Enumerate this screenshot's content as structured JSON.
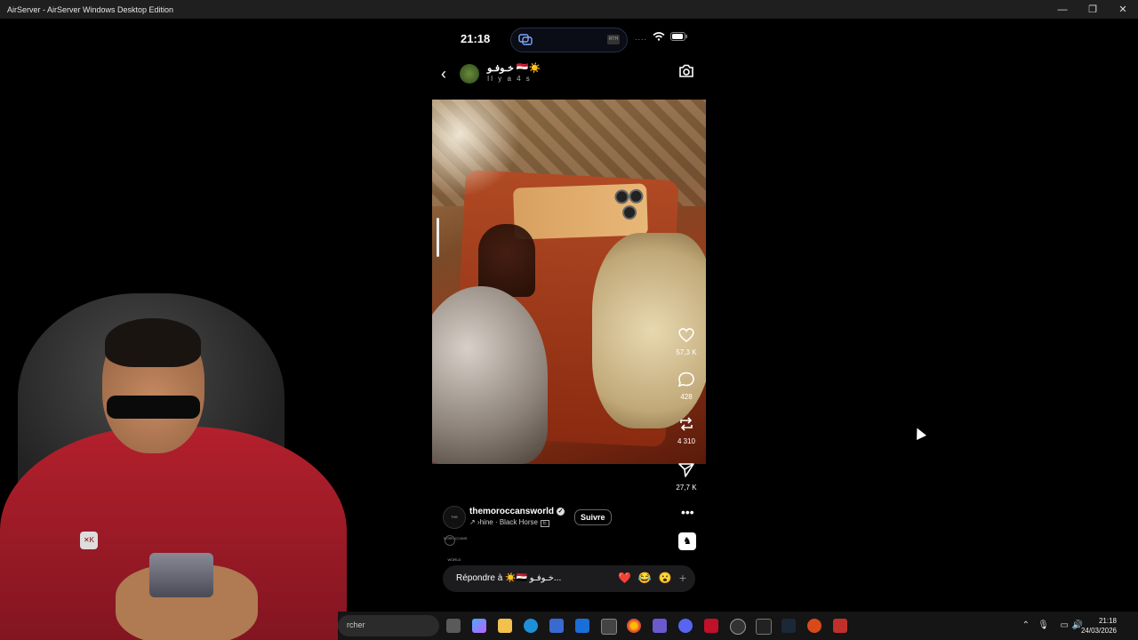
{
  "window": {
    "title": "AirServer - AirServer Windows Desktop Edition",
    "minimize": "—",
    "restore": "❐",
    "close": "✕"
  },
  "phone_status": {
    "time": "21:18",
    "dots": "....",
    "badge": "RTH"
  },
  "story": {
    "username": "خـوفـو 🇪🇬☀️",
    "time_ago": "Il y a 4 s",
    "back_icon": "chevron-left-icon",
    "camera_icon": "camera-icon"
  },
  "actions": {
    "likes": "57,3 K",
    "comments": "428",
    "reposts": "4 310",
    "shares": "27,7 K"
  },
  "post": {
    "account": "themoroccansworld",
    "account_avatar_text": "THE MOROCCANS WORLD",
    "music": "↗ ›hine · Black Horse",
    "explicit": "E",
    "follow_label": "Suivre",
    "more_label": "•••"
  },
  "reply": {
    "placeholder": "Répondre à ☀️🇪🇬 خـوفـو...",
    "reactions": [
      "❤️",
      "😂",
      "😮"
    ],
    "plus": "+"
  },
  "taskbar": {
    "search_text": "rcher",
    "clock_time": "21:18",
    "clock_date": "24/03/2026"
  },
  "colors": {
    "background": "#000000",
    "titlebar": "#1f1f1f",
    "replybar": "#1c1c1e",
    "jacket": "#b3202c"
  }
}
